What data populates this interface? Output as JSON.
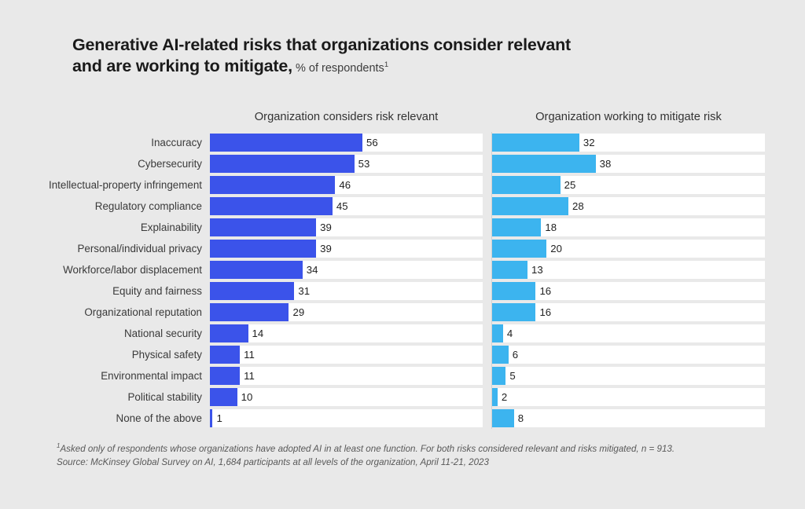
{
  "title": {
    "line1": "Generative AI-related risks that organizations consider relevant",
    "line2": "and are working to mitigate,",
    "subtitle": "% of respondents",
    "subtitle_marker": "1"
  },
  "columns": {
    "left_header": "Organization considers risk relevant",
    "right_header": "Organization working to mitigate risk"
  },
  "footnotes": {
    "marker": "1",
    "line1": "Asked only of respondents whose organizations have adopted AI in at least one function. For both risks considered relevant and risks mitigated, n = 913.",
    "line2": "Source: McKinsey Global Survey on AI, 1,684 participants at all levels of the organization, April 11-21, 2023"
  },
  "colors": {
    "relevant_bar": "#3b53ea",
    "mitigate_bar": "#3cb4ef",
    "background": "#e9e9e9",
    "track": "#ffffff"
  },
  "chart_data": {
    "type": "bar",
    "title": "Generative AI-related risks that organizations consider relevant and are working to mitigate, % of respondents",
    "xlabel": "",
    "ylabel": "",
    "xlim": [
      0,
      100
    ],
    "grid": false,
    "orientation": "horizontal",
    "legend_position": "column-headers",
    "categories": [
      "Inaccuracy",
      "Cybersecurity",
      "Intellectual-property infringement",
      "Regulatory compliance",
      "Explainability",
      "Personal/individual privacy",
      "Workforce/labor displacement",
      "Equity and fairness",
      "Organizational reputation",
      "National security",
      "Physical safety",
      "Environmental impact",
      "Political stability",
      "None of the above"
    ],
    "series": [
      {
        "name": "Organization considers risk relevant",
        "color": "#3b53ea",
        "values": [
          56,
          53,
          46,
          45,
          39,
          39,
          34,
          31,
          29,
          14,
          11,
          11,
          10,
          1
        ]
      },
      {
        "name": "Organization working to mitigate risk",
        "color": "#3cb4ef",
        "values": [
          32,
          38,
          25,
          28,
          18,
          20,
          13,
          16,
          16,
          4,
          6,
          5,
          2,
          8
        ]
      }
    ]
  }
}
